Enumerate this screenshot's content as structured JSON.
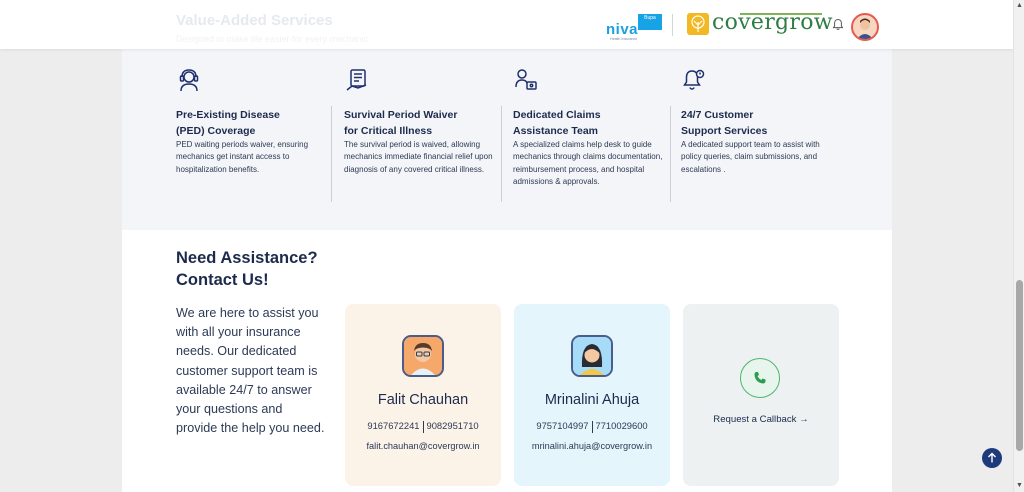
{
  "header": {
    "ghost_title": "Value-Added Services",
    "ghost_subtitle": "Designed to make life easier for every mechanic",
    "niva_word": "niva",
    "niva_box": "Bupa",
    "niva_tagline": "Health Insurance",
    "brand": "covergrow",
    "bell_icon": "bell-icon",
    "avatar_icon": "user-avatar"
  },
  "features": [
    {
      "icon": "headset-agent-icon",
      "title_line1": "Pre-Existing Disease",
      "title_line2": "(PED) Coverage",
      "description": "PED waiting periods waiver, ensuring mechanics get instant access to hospitalization benefits."
    },
    {
      "icon": "clipboard-checklist-icon",
      "title_line1": "Survival Period Waiver",
      "title_line2": "for Critical Illness",
      "description": "The survival period is waived, allowing mechanics immediate financial relief upon diagnosis of any covered critical illness."
    },
    {
      "icon": "person-desk-icon",
      "title_line1": "Dedicated Claims",
      "title_line2": "Assistance Team",
      "description": "A specialized claims help desk to guide mechanics through claims documentation, reimbursement process, and hospital admissions & approvals."
    },
    {
      "icon": "bell-alert-icon",
      "title_line1": "24/7 Customer",
      "title_line2": "Support Services",
      "description": "A dedicated support team to assist with policy queries, claim submissions, and escalations ."
    }
  ],
  "assistance": {
    "title_line1": "Need Assistance?",
    "title_line2": "Contact Us!",
    "text": "We are here to assist you with all your insurance needs. Our dedicated customer support team is available 24/7 to answer your questions and provide the help you need."
  },
  "contacts": [
    {
      "name": "Falit Chauhan",
      "phone1": "9167672241",
      "phone2": "9082951710",
      "email": "falit.chauhan@covergrow.in",
      "accent": "#fbf2e8"
    },
    {
      "name": "Mrinalini Ahuja",
      "phone1": "9757104997",
      "phone2": "7710029600",
      "email": "mrinalini.ahuja@covergrow.in",
      "accent": "#e4f5fb"
    }
  ],
  "callback": {
    "label": "Request a Callback →",
    "icon": "phone-icon"
  },
  "scroll_top_icon": "arrow-up-icon",
  "colors": {
    "primary_text": "#1c2b4d",
    "brand_green": "#2e7d44",
    "accent_blue": "#1f3a7a"
  }
}
